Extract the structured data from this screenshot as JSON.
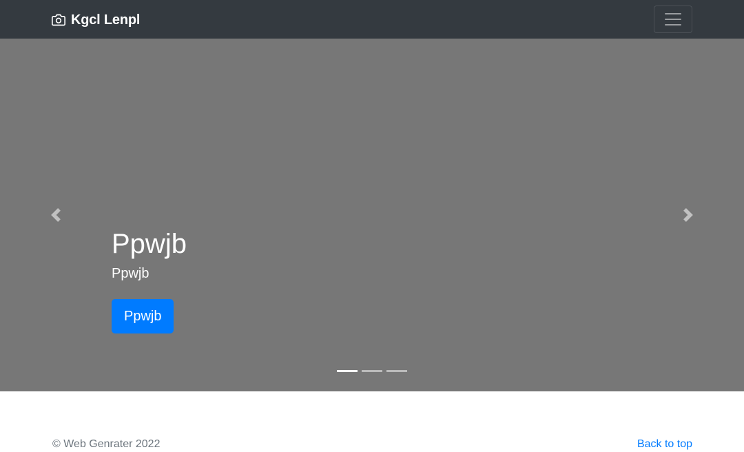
{
  "navbar": {
    "brand_icon": "camera-icon",
    "brand_name": "Kgcl Lenpl",
    "toggler_icon": "hamburger-menu-icon",
    "background_color": "#343a40"
  },
  "carousel": {
    "background_color": "#777777",
    "heading": "Ppwjb",
    "subtitle": "Ppwjb",
    "button_label": "Ppwjb",
    "button_color": "#007bff",
    "prev_icon": "chevron-left-icon",
    "next_icon": "chevron-right-icon",
    "slide_count": 3,
    "active_slide": 1
  },
  "footer": {
    "copyright": "© Web Genrater 2022",
    "back_to_top": "Back to top",
    "link_color": "#007bff"
  }
}
